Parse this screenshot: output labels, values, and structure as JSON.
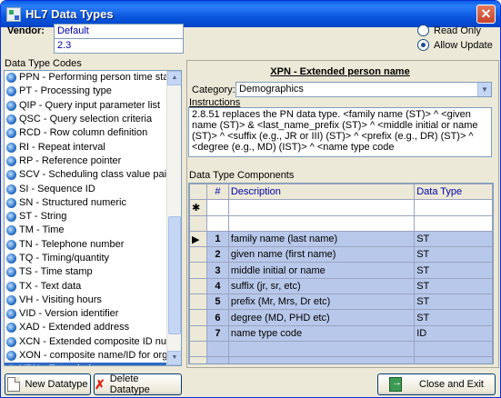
{
  "window": {
    "title": "HL7 Data Types",
    "close_symbol": "✕"
  },
  "vendor": {
    "label": "Vendor:",
    "value": "Default",
    "version": "2.3"
  },
  "mode": {
    "read_only_label": "Read Only",
    "allow_update_label": "Allow Update",
    "selected": "allow_update"
  },
  "data_types": {
    "label": "Data Type Codes",
    "items": [
      "PPN - Performing person time stamp",
      "PT - Processing type",
      "QIP - Query input parameter list",
      "QSC - Query selection criteria",
      "RCD - Row column definition",
      "RI - Repeat interval",
      "RP - Reference pointer",
      "SCV - Scheduling class value pair",
      "SI - Sequence ID",
      "SN - Structured numeric",
      "ST - String",
      "TM - Time",
      "TN - Telephone number",
      "TQ - Timing/quantity",
      "TS - Time stamp",
      "TX - Text data",
      "VH - Visiting hours",
      "VID - Version identifier",
      "XAD - Extended address",
      "XCN - Extended composite ID number and",
      "XON - composite name/ID for organization",
      "XPN - Extended person name",
      "XTN - Extended telecommunications num"
    ],
    "selected_index": 21
  },
  "detail": {
    "title": "XPN - Extended person name",
    "category_label": "Category:",
    "category_value": "Demographics",
    "instructions_label": "Instructions",
    "instructions": "2.8.51 replaces the PN data type.  <family name (ST)> ^ <given name (ST)> & <last_name_prefix (ST)> ^ <middle initial or name (ST)> ^ <suffix (e.g., JR or III) (ST)> ^ <prefix (e.g., DR) (ST)> ^ <degree (e.g., MD) (IST)> ^ <name type code"
  },
  "components": {
    "label": "Data Type Components",
    "columns": {
      "num": "#",
      "description": "Description",
      "data_type": "Data Type"
    },
    "new_row_marker": "✱",
    "current_row_marker": "▶",
    "rows": [
      {
        "num": "1",
        "description": "family name (last name)",
        "data_type": "ST"
      },
      {
        "num": "2",
        "description": "given name (first name)",
        "data_type": "ST"
      },
      {
        "num": "3",
        "description": "middle initial or name",
        "data_type": "ST"
      },
      {
        "num": "4",
        "description": "suffix (jr, sr, etc)",
        "data_type": "ST"
      },
      {
        "num": "5",
        "description": "prefix (Mr, Mrs, Dr etc)",
        "data_type": "ST"
      },
      {
        "num": "6",
        "description": "degree (MD, PHD etc)",
        "data_type": "ST"
      },
      {
        "num": "7",
        "description": "name type code",
        "data_type": "ID"
      }
    ]
  },
  "buttons": {
    "new": "New Datatype",
    "delete": "Delete Datatype",
    "close": "Close and Exit"
  }
}
